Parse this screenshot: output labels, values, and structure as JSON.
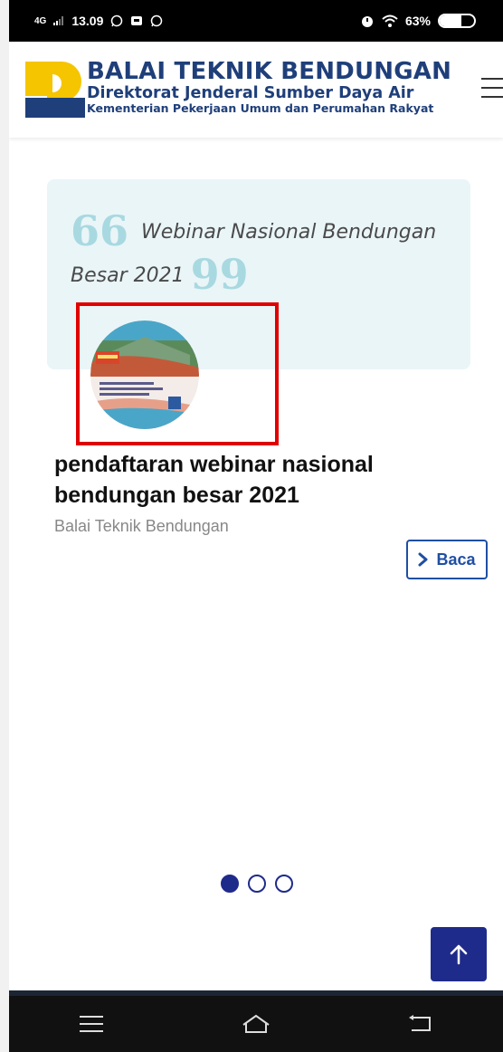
{
  "status_bar": {
    "network": "4G",
    "time": "13.09",
    "battery": "63%",
    "battery_level": 0.63
  },
  "header": {
    "title": "BALAI TEKNIK BENDUNGAN",
    "subtitle": "Direktorat Jenderal Sumber Daya Air",
    "subtitle2": "Kementerian Pekerjaan Umum dan Perumahan Rakyat",
    "logo_icon": "pu-logo",
    "menu_icon": "hamburger-icon"
  },
  "quote": {
    "open_mark": "66",
    "text_line1": "Webinar Nasional Bendungan",
    "text_line2": "Besar 2021",
    "close_mark": "99"
  },
  "article": {
    "title_line1": "pendaftaran webinar nasional",
    "title_line2": "bendungan besar 2021",
    "author": "Balai Teknik Bendungan",
    "read_label": "Baca",
    "thumbnail_label": "webinar-poster"
  },
  "carousel": {
    "slides": 3,
    "active": 0
  },
  "colors": {
    "brand": "#1f3f7a",
    "accent": "#1f2b8a",
    "highlight": "#e00000",
    "quote_bg": "#eaf5f8",
    "logo_yellow": "#f5c500"
  },
  "nav": {
    "menu_icon": "nav-menu-icon",
    "home_icon": "nav-home-icon",
    "back_icon": "nav-back-icon"
  }
}
